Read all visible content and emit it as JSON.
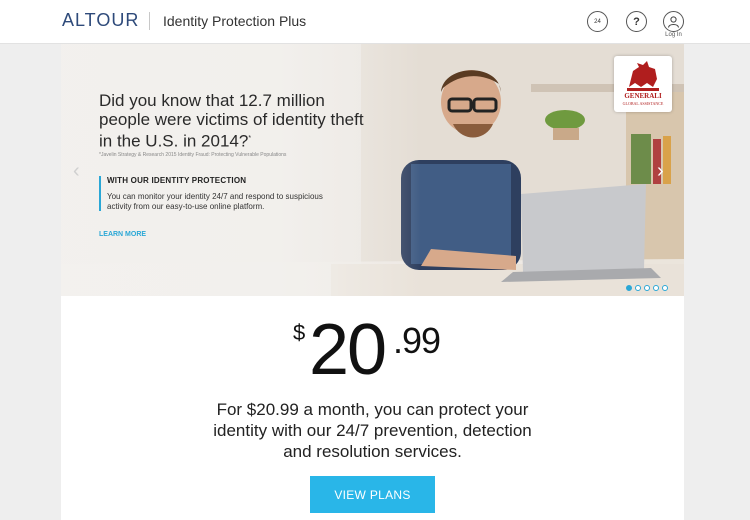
{
  "header": {
    "brand": "ALTOUR",
    "product": "Identity Protection Plus",
    "phone_badge": "24",
    "help_glyph": "?",
    "login_label": "Log In"
  },
  "hero": {
    "headline": "Did you know that 12.7 million people were victims of identity theft in the U.S. in 2014?",
    "headline_mark": "*",
    "source": "*Javelin Strategy & Research 2015 Identity Fraud: Protecting Vulnerable Populations",
    "box_title": "WITH OUR IDENTITY PROTECTION",
    "box_body": "You can monitor your identity 24/7 and respond to suspicious activity from our easy-to-use online platform.",
    "learn_more": "LEARN MORE",
    "prev_arrow": "‹",
    "next_arrow": "›",
    "partner_logo": "GENERALI",
    "partner_sub": "GLOBAL ASSISTANCE",
    "slides_total": 5,
    "active_slide": 1
  },
  "pricing": {
    "currency": "$",
    "amount": "20",
    "cents": ".99",
    "tagline_lines": [
      "For $20.99 a month, you can protect your",
      "identity with our 24/7 prevention, detection",
      "and resolution services."
    ],
    "cta": "VIEW PLANS"
  },
  "colors": {
    "accent": "#29b6e8",
    "brand": "#2e4a7a",
    "partner_red": "#b01e1e"
  }
}
